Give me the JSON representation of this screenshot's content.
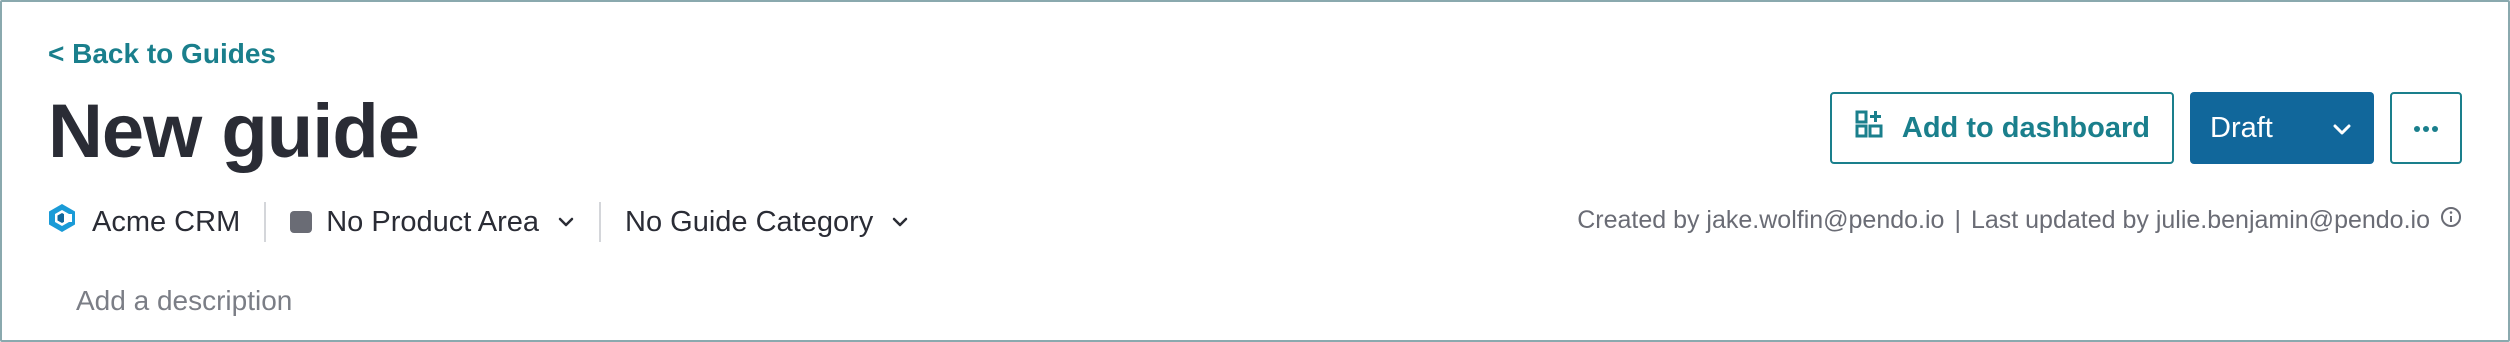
{
  "header": {
    "back_link": "< Back to Guides",
    "title": "New guide"
  },
  "actions": {
    "add_to_dashboard": "Add to dashboard",
    "status": "Draft",
    "more_icon": "ellipsis-icon"
  },
  "meta": {
    "app_name": "Acme CRM",
    "product_area": "No Product Area",
    "guide_category": "No Guide Category",
    "created_by": "Created by jake.wolfin@pendo.io",
    "separator": "|",
    "last_updated_by": "Last updated by julie.benjamin@pendo.io"
  },
  "description": {
    "placeholder": "Add a description"
  },
  "colors": {
    "accent_teal": "#1a7f8c",
    "draft_blue": "#11679b",
    "title": "#2a2c35",
    "muted": "#6a6c75",
    "frame_border": "#8aa9ae"
  }
}
